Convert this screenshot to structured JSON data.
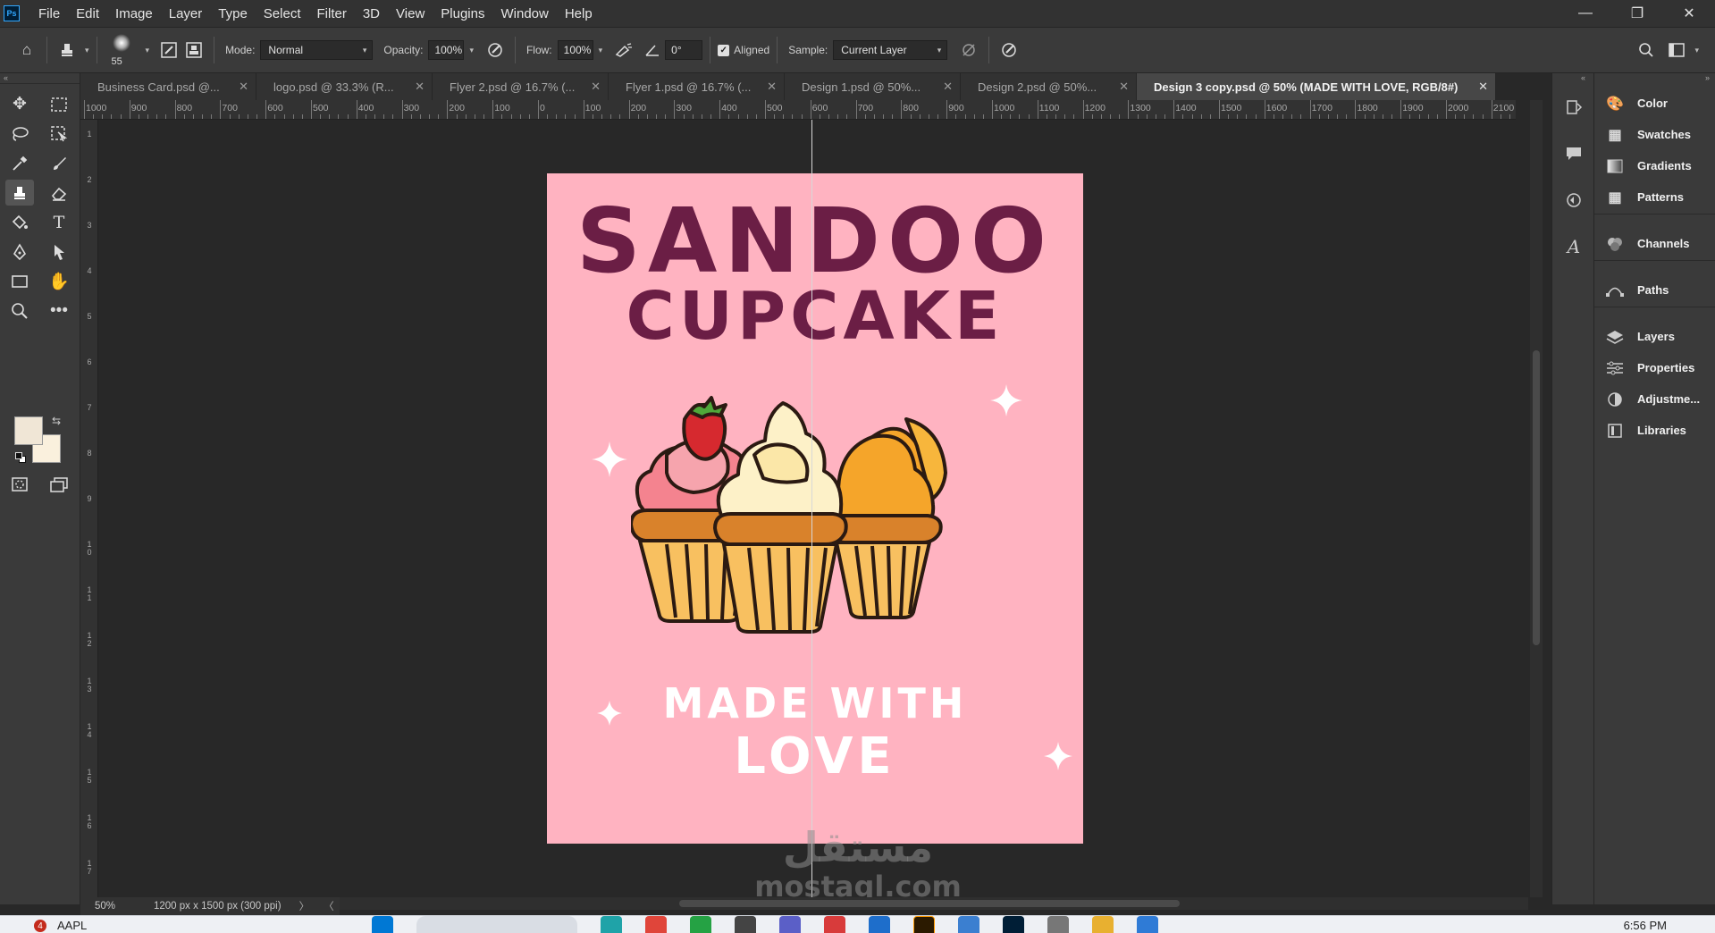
{
  "app": {
    "logo": "Ps"
  },
  "menu": [
    "File",
    "Edit",
    "Image",
    "Layer",
    "Type",
    "Select",
    "Filter",
    "3D",
    "View",
    "Plugins",
    "Window",
    "Help"
  ],
  "window_controls": {
    "minimize": "—",
    "restore": "❐",
    "close": "✕"
  },
  "options": {
    "brush_size": "55",
    "mode_label": "Mode:",
    "mode_value": "Normal",
    "opacity_label": "Opacity:",
    "opacity_value": "100%",
    "flow_label": "Flow:",
    "flow_value": "100%",
    "angle_value": "0°",
    "aligned_label": "Aligned",
    "aligned_checked": true,
    "sample_label": "Sample:",
    "sample_value": "Current Layer"
  },
  "tabs": [
    {
      "title": "Business Card.psd @...",
      "active": false
    },
    {
      "title": "logo.psd @ 33.3% (R...",
      "active": false
    },
    {
      "title": "Flyer 2.psd @ 16.7% (...",
      "active": false
    },
    {
      "title": "Flyer 1.psd @ 16.7% (...",
      "active": false
    },
    {
      "title": "Design 1.psd @ 50%...",
      "active": false
    },
    {
      "title": "Design 2.psd @ 50%...",
      "active": false
    },
    {
      "title": "Design 3 copy.psd @ 50% (MADE WITH  LOVE, RGB/8#)",
      "active": true
    }
  ],
  "ruler_top": [
    "1000",
    "900",
    "800",
    "700",
    "600",
    "500",
    "400",
    "300",
    "200",
    "100",
    "0",
    "100",
    "200",
    "300",
    "400",
    "500",
    "600",
    "700",
    "800",
    "900",
    "1000",
    "1100",
    "1200",
    "1300",
    "1400",
    "1500",
    "1600",
    "1700",
    "1800",
    "1900",
    "2000",
    "2100"
  ],
  "ruler_left": [
    "1",
    "2",
    "3",
    "4",
    "5",
    "6",
    "7",
    "8",
    "9",
    "1\n0",
    "1\n1",
    "1\n2",
    "1\n3",
    "1\n4",
    "1\n5",
    "1\n6",
    "1\n7"
  ],
  "document": {
    "background": "#ffb3c1",
    "title_line1": "SANDOO",
    "title_line2": "CUPCAKE",
    "tagline_line1": "MADE WITH",
    "tagline_line2": "LOVE",
    "title_color": "#6b1e45"
  },
  "watermark": {
    "arabic": "مستقل",
    "latin": "mostaql.com"
  },
  "status": {
    "zoom": "50%",
    "doc_info": "1200 px x 1500 px (300 ppi)",
    "arrow": "〉",
    "left_arrow": "〈"
  },
  "colors": {
    "foreground": "#f0e6d6",
    "background": "#faf0dd"
  },
  "right_panel": [
    {
      "label": "Color",
      "icon": "palette-icon"
    },
    {
      "label": "Swatches",
      "icon": "grid-icon"
    },
    {
      "label": "Gradients",
      "icon": "gradient-icon"
    },
    {
      "label": "Patterns",
      "icon": "grid-icon"
    },
    {
      "label": "Channels",
      "icon": "channels-icon"
    },
    {
      "label": "Paths",
      "icon": "path-icon"
    },
    {
      "label": "Layers",
      "icon": "layers-icon"
    },
    {
      "label": "Properties",
      "icon": "sliders-icon"
    },
    {
      "label": "Adjustme...",
      "icon": "adjust-icon"
    },
    {
      "label": "Libraries",
      "icon": "library-icon"
    }
  ],
  "taskbar": {
    "badge": "4",
    "ticker": "AAPL",
    "clock": "6:56 PM"
  }
}
